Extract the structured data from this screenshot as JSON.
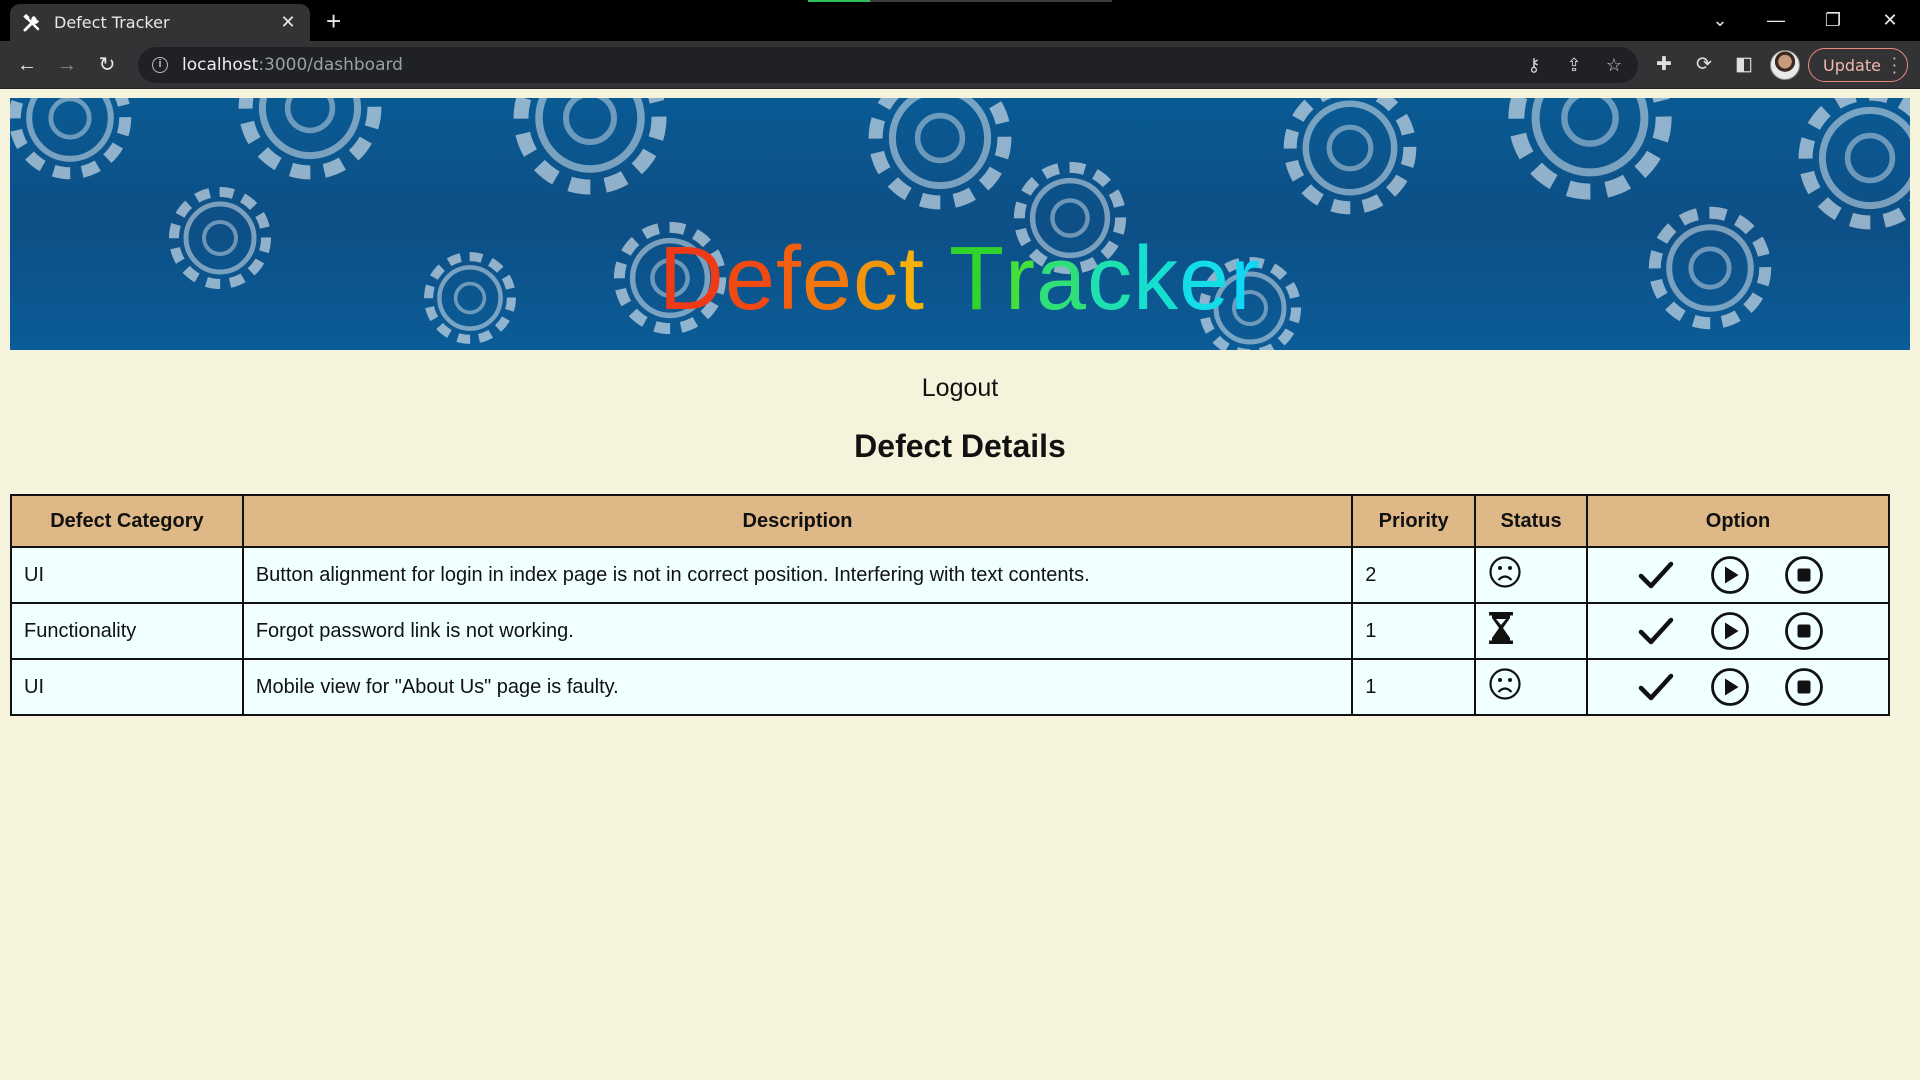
{
  "browser": {
    "tab_title": "Defect Tracker",
    "url_host": "localhost",
    "url_path": ":3000/dashboard",
    "update_label": "Update"
  },
  "banner": {
    "title_words": [
      {
        "text": "Defect",
        "colors": [
          "#ee3a16",
          "#f04a12",
          "#f25f10",
          "#f2760e",
          "#f3950b",
          "#f5b00a"
        ]
      },
      {
        "text": "Tracker",
        "colors": [
          "#31d42c",
          "#43e03a",
          "#2fe07a",
          "#1fe0b0",
          "#17dfcf",
          "#14dde8",
          "#10d8f4"
        ]
      }
    ]
  },
  "page": {
    "logout_label": "Logout",
    "section_title": "Defect Details"
  },
  "table": {
    "headers": [
      "Defect Category",
      "Description",
      "Priority",
      "Status",
      "Option"
    ],
    "rows": [
      {
        "category": "UI",
        "description": "Button alignment for login in index page is not in correct position. Interfering with text contents.",
        "priority": "2",
        "status_icon": "sad-face-icon"
      },
      {
        "category": "Functionality",
        "description": "Forgot password link is not working.",
        "priority": "1",
        "status_icon": "hourglass-icon"
      },
      {
        "category": "UI",
        "description": "Mobile view for \"About Us\" page is faulty.",
        "priority": "1",
        "status_icon": "sad-face-icon"
      }
    ],
    "option_icons": [
      "checkmark-icon",
      "play-icon",
      "stop-icon"
    ]
  },
  "colors": {
    "page_bg": "#f5f3dc",
    "header_bg": "#deb887",
    "cell_bg": "#f0ffff",
    "banner_bg": "#0d4f86"
  }
}
